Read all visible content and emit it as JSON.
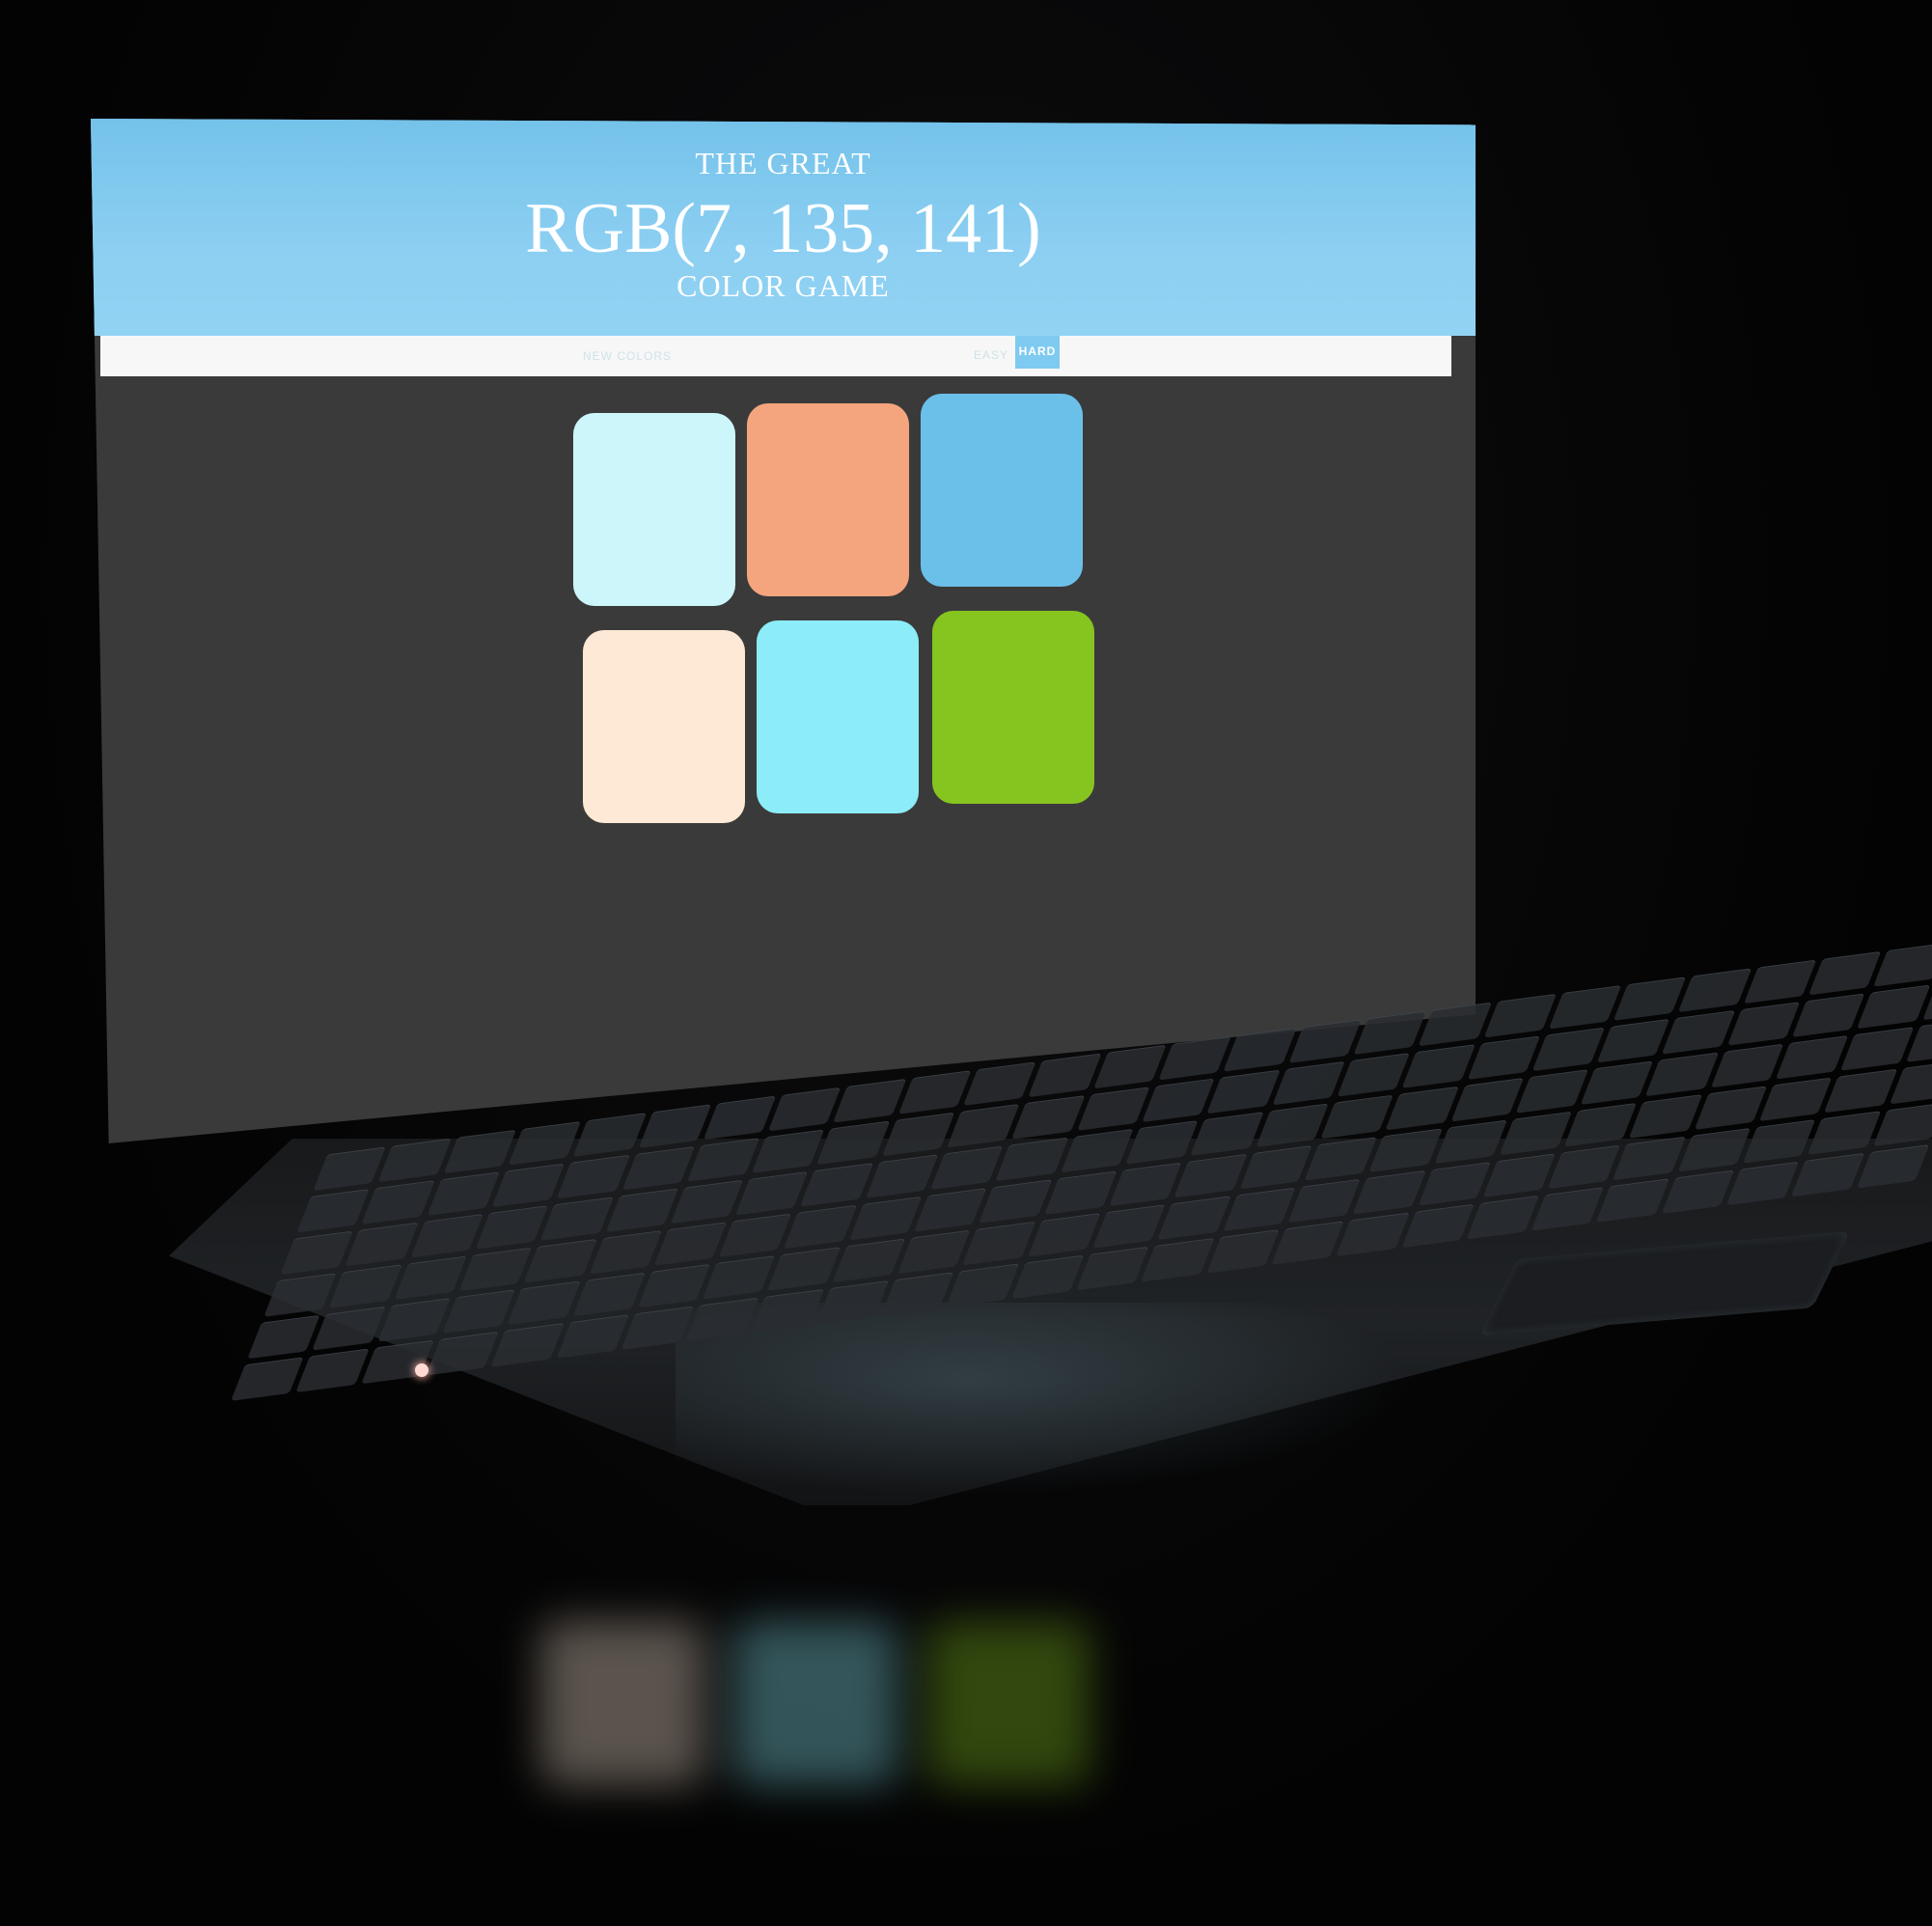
{
  "game": {
    "title_top": "THE GREAT",
    "rgb_target": "RGB(7, 135, 141)",
    "title_bottom": "COLOR GAME",
    "new_colors_label": "NEW COLORS",
    "easy_label": "EASY",
    "hard_label": "HARD",
    "header_color": "#84c9ee",
    "background_color": "#3a3a3a"
  },
  "squares": [
    {
      "color": "#cdf6fb"
    },
    {
      "color": "#f4a57e"
    },
    {
      "color": "#6bc0ea"
    },
    {
      "color": "#fde9d6"
    },
    {
      "color": "#8cecf8"
    },
    {
      "color": "#86c420"
    }
  ]
}
